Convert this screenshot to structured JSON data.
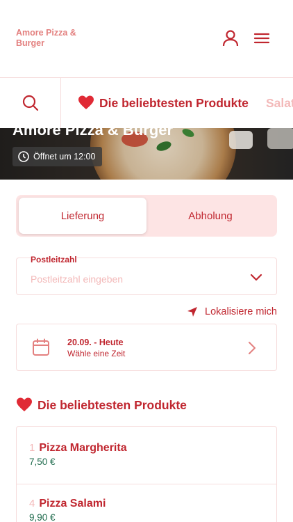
{
  "header": {
    "brand": "Amore Pizza & Burger",
    "icons": {
      "account": "user-icon",
      "menu": "hamburger-menu-icon"
    }
  },
  "categories": {
    "active": "Die beliebtesten Produkte",
    "next": "Salat"
  },
  "hero": {
    "title": "Amore Pizza & Burger",
    "hours": "Öffnet um 12:00"
  },
  "delivery_toggle": {
    "options": [
      "Lieferung",
      "Abholung"
    ],
    "selected": "Lieferung"
  },
  "postal_code": {
    "label": "Postleitzahl",
    "placeholder": "Postleitzahl eingeben",
    "value": ""
  },
  "locate_label": "Lokalisiere mich",
  "date": {
    "main": "20.09. - Heute",
    "sub": "Wähle eine Zeit"
  },
  "popular": {
    "title": "Die beliebtesten Produkte",
    "items": [
      {
        "number": "1",
        "name": "Pizza Margherita",
        "price": "7,50 €"
      },
      {
        "number": "4",
        "name": "Pizza Salami",
        "price": "9,90 €"
      }
    ]
  },
  "colors": {
    "accent": "#c0262f",
    "accent_light": "#f3b9b9",
    "toggle_bg": "#fde4e4",
    "price": "#1f6b4d"
  }
}
